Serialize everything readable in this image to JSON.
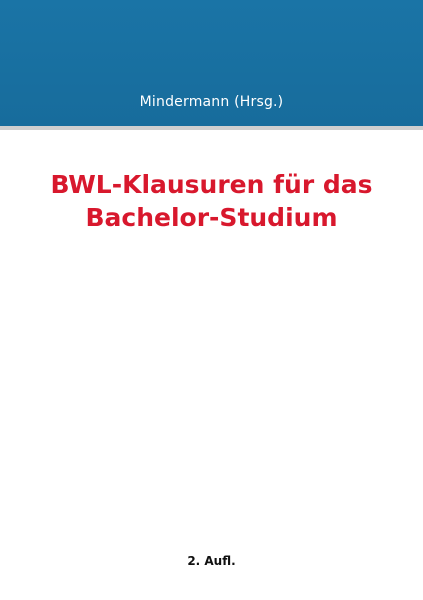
{
  "cover": {
    "editor": "Mindermann (Hrsg.)",
    "title_line_1": "BWL-Klausuren für das",
    "title_line_2": "Bachelor-Studium",
    "edition": "2. Aufl.",
    "colors": {
      "band": "#1a74a6",
      "title": "#d8182d",
      "rule": "#cfcfcf"
    }
  }
}
